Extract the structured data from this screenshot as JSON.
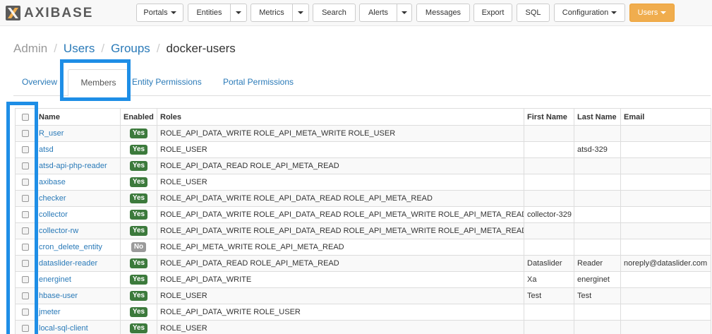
{
  "brand": {
    "name": "AXIBASE",
    "icon": "axibase-logo-icon",
    "accent": "#f0ad4e"
  },
  "nav": {
    "portals": "Portals",
    "entities": "Entities",
    "metrics": "Metrics",
    "search": "Search",
    "alerts": "Alerts",
    "messages": "Messages",
    "export": "Export",
    "sql": "SQL",
    "configuration": "Configuration",
    "users": "Users"
  },
  "breadcrumb": {
    "admin": "Admin",
    "users": "Users",
    "groups": "Groups",
    "separator": "/",
    "current": "docker-users"
  },
  "tabs": {
    "overview": "Overview",
    "members": "Members",
    "entity_permissions": "Entity Permissions",
    "portal_permissions": "Portal Permissions"
  },
  "table": {
    "headers": {
      "name": "Name",
      "enabled": "Enabled",
      "roles": "Roles",
      "first_name": "First Name",
      "last_name": "Last Name",
      "email": "Email"
    },
    "rows": [
      {
        "name": "R_user",
        "enabled": "Yes",
        "roles": "ROLE_API_DATA_WRITE ROLE_API_META_WRITE ROLE_USER",
        "first_name": "",
        "last_name": "",
        "email": ""
      },
      {
        "name": "atsd",
        "enabled": "Yes",
        "roles": "ROLE_USER",
        "first_name": "",
        "last_name": "atsd-329",
        "email": ""
      },
      {
        "name": "atsd-api-php-reader",
        "enabled": "Yes",
        "roles": "ROLE_API_DATA_READ ROLE_API_META_READ",
        "first_name": "",
        "last_name": "",
        "email": ""
      },
      {
        "name": "axibase",
        "enabled": "Yes",
        "roles": "ROLE_USER",
        "first_name": "",
        "last_name": "",
        "email": ""
      },
      {
        "name": "checker",
        "enabled": "Yes",
        "roles": "ROLE_API_DATA_WRITE ROLE_API_DATA_READ ROLE_API_META_READ",
        "first_name": "",
        "last_name": "",
        "email": ""
      },
      {
        "name": "collector",
        "enabled": "Yes",
        "roles": "ROLE_API_DATA_WRITE ROLE_API_DATA_READ ROLE_API_META_WRITE ROLE_API_META_READ",
        "first_name": "collector-329",
        "last_name": "",
        "email": ""
      },
      {
        "name": "collector-rw",
        "enabled": "Yes",
        "roles": "ROLE_API_DATA_WRITE ROLE_API_DATA_READ ROLE_API_META_WRITE ROLE_API_META_READ",
        "first_name": "",
        "last_name": "",
        "email": ""
      },
      {
        "name": "cron_delete_entity",
        "enabled": "No",
        "roles": "ROLE_API_META_WRITE ROLE_API_META_READ",
        "first_name": "",
        "last_name": "",
        "email": ""
      },
      {
        "name": "dataslider-reader",
        "enabled": "Yes",
        "roles": "ROLE_API_DATA_READ ROLE_API_META_READ",
        "first_name": "Dataslider",
        "last_name": "Reader",
        "email": "noreply@dataslider.com"
      },
      {
        "name": "energinet",
        "enabled": "Yes",
        "roles": "ROLE_API_DATA_WRITE",
        "first_name": "Xa",
        "last_name": "energinet",
        "email": ""
      },
      {
        "name": "hbase-user",
        "enabled": "Yes",
        "roles": "ROLE_USER",
        "first_name": "Test",
        "last_name": "Test",
        "email": ""
      },
      {
        "name": "jmeter",
        "enabled": "Yes",
        "roles": "ROLE_API_DATA_WRITE ROLE_USER",
        "first_name": "",
        "last_name": "",
        "email": ""
      },
      {
        "name": "local-sql-client",
        "enabled": "Yes",
        "roles": "ROLE_USER",
        "first_name": "",
        "last_name": "",
        "email": ""
      }
    ]
  }
}
